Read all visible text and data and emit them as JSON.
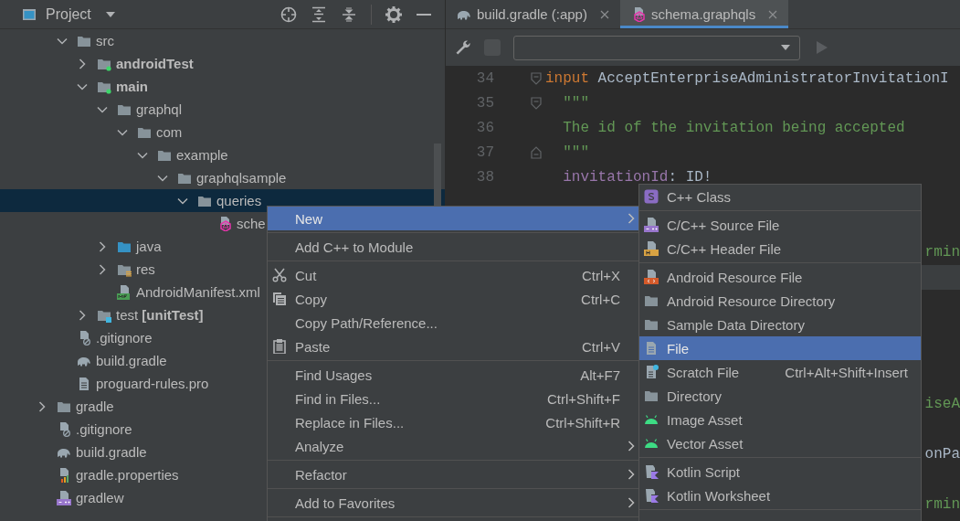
{
  "panel": {
    "title": "Project"
  },
  "tree": [
    {
      "children": [
        {
          "label": "src",
          "kind": "folder",
          "expanded": true,
          "selected": false,
          "children": [
            {
              "label": "androidTest",
              "kind": "module-folder",
              "bold": true,
              "expanded": false,
              "selected": false
            },
            {
              "label": "main",
              "kind": "module-folder",
              "bold": true,
              "expanded": true,
              "selected": false,
              "children": [
                {
                  "label": "graphql",
                  "kind": "folder",
                  "expanded": true,
                  "selected": false,
                  "children": [
                    {
                      "label": "com",
                      "kind": "folder",
                      "expanded": true,
                      "selected": false,
                      "children": [
                        {
                          "label": "example",
                          "kind": "folder",
                          "expanded": true,
                          "selected": false,
                          "children": [
                            {
                              "label": "graphqlsample",
                              "kind": "folder",
                              "expanded": true,
                              "selected": false,
                              "children": [
                                {
                                  "label": "queries",
                                  "kind": "folder",
                                  "expanded": true,
                                  "selected": true,
                                  "children": [
                                    {
                                      "label": "sche",
                                      "kind": "graphql",
                                      "selected": false
                                    }
                                  ]
                                }
                              ]
                            }
                          ]
                        }
                      ]
                    }
                  ]
                },
                {
                  "label": "java",
                  "kind": "source-folder",
                  "expanded": false,
                  "selected": false
                },
                {
                  "label": "res",
                  "kind": "res-folder",
                  "expanded": false,
                  "selected": false
                },
                {
                  "label": "AndroidManifest.xml",
                  "kind": "manifest",
                  "selected": false
                }
              ]
            },
            {
              "label": "test **[unitTest]**",
              "kind": "test-folder",
              "expanded": false,
              "selected": false
            }
          ]
        },
        {
          "label": ".gitignore",
          "kind": "gitignore",
          "selected": false
        },
        {
          "label": "build.gradle",
          "kind": "gradle",
          "selected": false
        },
        {
          "label": "proguard-rules.pro",
          "kind": "text",
          "selected": false
        }
      ]
    },
    {
      "label": "gradle",
      "kind": "folder",
      "expanded": false,
      "selected": false
    },
    {
      "label": ".gitignore",
      "kind": "gitignore",
      "selected": false
    },
    {
      "label": "build.gradle",
      "kind": "gradle",
      "selected": false
    },
    {
      "label": "gradle.properties",
      "kind": "properties",
      "selected": false
    },
    {
      "label": "gradlew",
      "kind": "cpp",
      "selected": false
    }
  ],
  "editor_tabs": [
    {
      "label": "build.gradle (:app)",
      "kind": "gradle",
      "selected": false
    },
    {
      "label": "schema.graphqls",
      "kind": "graphql",
      "selected": true
    }
  ],
  "code_lines": [
    {
      "number": "34",
      "fold_open": true,
      "fold_close": false,
      "segments": [
        {
          "text": "input",
          "kind": "keyword"
        },
        {
          "text": " AcceptEnterpriseAdministratorInvitationI",
          "kind": "plain"
        }
      ]
    },
    {
      "number": "35",
      "fold_open": true,
      "fold_close": false,
      "segments": [
        {
          "text": "  \"\"\"",
          "kind": "doc"
        }
      ]
    },
    {
      "number": "36",
      "fold_open": false,
      "fold_close": false,
      "segments": [
        {
          "text": "  The id of the invitation being accepted",
          "kind": "doc"
        }
      ]
    },
    {
      "number": "37",
      "fold_open": false,
      "fold_close": true,
      "segments": [
        {
          "text": "  \"\"\"",
          "kind": "doc"
        }
      ]
    },
    {
      "number": "38",
      "fold_open": false,
      "fold_close": false,
      "segments": [
        {
          "text": "  invitationId",
          "kind": "field"
        },
        {
          "text": ": ID!",
          "kind": "plain"
        }
      ]
    }
  ],
  "hidden_lines": [
    {
      "current": false
    },
    {
      "current": false
    },
    {
      "current": false,
      "tail": [
        {
          "text": "rmin",
          "kind": "doc"
        }
      ]
    },
    {
      "current": true
    },
    {
      "current": false
    },
    {
      "current": false
    },
    {
      "current": false
    },
    {
      "current": false
    },
    {
      "current": false,
      "tail": [
        {
          "text": "iseA",
          "kind": "doc"
        }
      ]
    },
    {
      "current": false
    },
    {
      "current": false,
      "tail": [
        {
          "text": "onPa",
          "kind": "plain"
        }
      ]
    },
    {
      "current": false
    },
    {
      "current": false,
      "tail": [
        {
          "text": "rmin",
          "kind": "doc"
        }
      ]
    }
  ],
  "context_menu": {
    "items": [
      {
        "kind": "plain",
        "label": "New",
        "has_submenu": true,
        "selected": true
      },
      {
        "kind": "separator"
      },
      {
        "kind": "plain",
        "label": "Add C++ to Module",
        "has_submenu": false,
        "selected": false
      },
      {
        "kind": "separator"
      },
      {
        "kind": "scissors",
        "label": "Cut",
        "shortcut": "Ctrl+X",
        "has_submenu": false,
        "selected": false
      },
      {
        "kind": "copy",
        "label": "Copy",
        "shortcut": "Ctrl+C",
        "has_submenu": false,
        "selected": false
      },
      {
        "kind": "plain",
        "label": "Copy Path/Reference...",
        "has_submenu": false,
        "selected": false
      },
      {
        "kind": "paste",
        "label": "Paste",
        "shortcut": "Ctrl+V",
        "has_submenu": false,
        "selected": false
      },
      {
        "kind": "separator"
      },
      {
        "kind": "plain",
        "label": "Find Usages",
        "shortcut": "Alt+F7",
        "has_submenu": false,
        "selected": false
      },
      {
        "kind": "plain",
        "label": "Find in Files...",
        "shortcut": "Ctrl+Shift+F",
        "has_submenu": false,
        "selected": false
      },
      {
        "kind": "plain",
        "label": "Replace in Files...",
        "shortcut": "Ctrl+Shift+R",
        "has_submenu": false,
        "selected": false
      },
      {
        "kind": "plain",
        "label": "Analyze",
        "has_submenu": true,
        "selected": false
      },
      {
        "kind": "separator"
      },
      {
        "kind": "plain",
        "label": "Refactor",
        "has_submenu": true,
        "selected": false
      },
      {
        "kind": "separator"
      },
      {
        "kind": "plain",
        "label": "Add to Favorites",
        "has_submenu": true,
        "selected": false
      },
      {
        "kind": "separator"
      }
    ]
  },
  "new_submenu": {
    "items": [
      {
        "kind": "class",
        "label": "C++ Class",
        "selected": false
      },
      {
        "kind": "separator"
      },
      {
        "kind": "cpp",
        "label": "C/C++ Source File",
        "selected": false
      },
      {
        "kind": "header",
        "label": "C/C++ Header File",
        "selected": false
      },
      {
        "kind": "separator"
      },
      {
        "kind": "resource",
        "label": "Android Resource File",
        "selected": false
      },
      {
        "kind": "folder",
        "label": "Android Resource Directory",
        "selected": false
      },
      {
        "kind": "folder",
        "label": "Sample Data Directory",
        "selected": false
      },
      {
        "kind": "file",
        "label": "File",
        "selected": true
      },
      {
        "kind": "scratch",
        "label": "Scratch File",
        "shortcut": "Ctrl+Alt+Shift+Insert",
        "selected": false
      },
      {
        "kind": "folder",
        "label": "Directory",
        "selected": false
      },
      {
        "kind": "android",
        "label": "Image Asset",
        "selected": false
      },
      {
        "kind": "android",
        "label": "Vector Asset",
        "selected": false
      },
      {
        "kind": "separator"
      },
      {
        "kind": "kotlin",
        "label": "Kotlin Script",
        "selected": false
      },
      {
        "kind": "kotlin",
        "label": "Kotlin Worksheet",
        "selected": false
      },
      {
        "kind": "separator"
      }
    ]
  }
}
